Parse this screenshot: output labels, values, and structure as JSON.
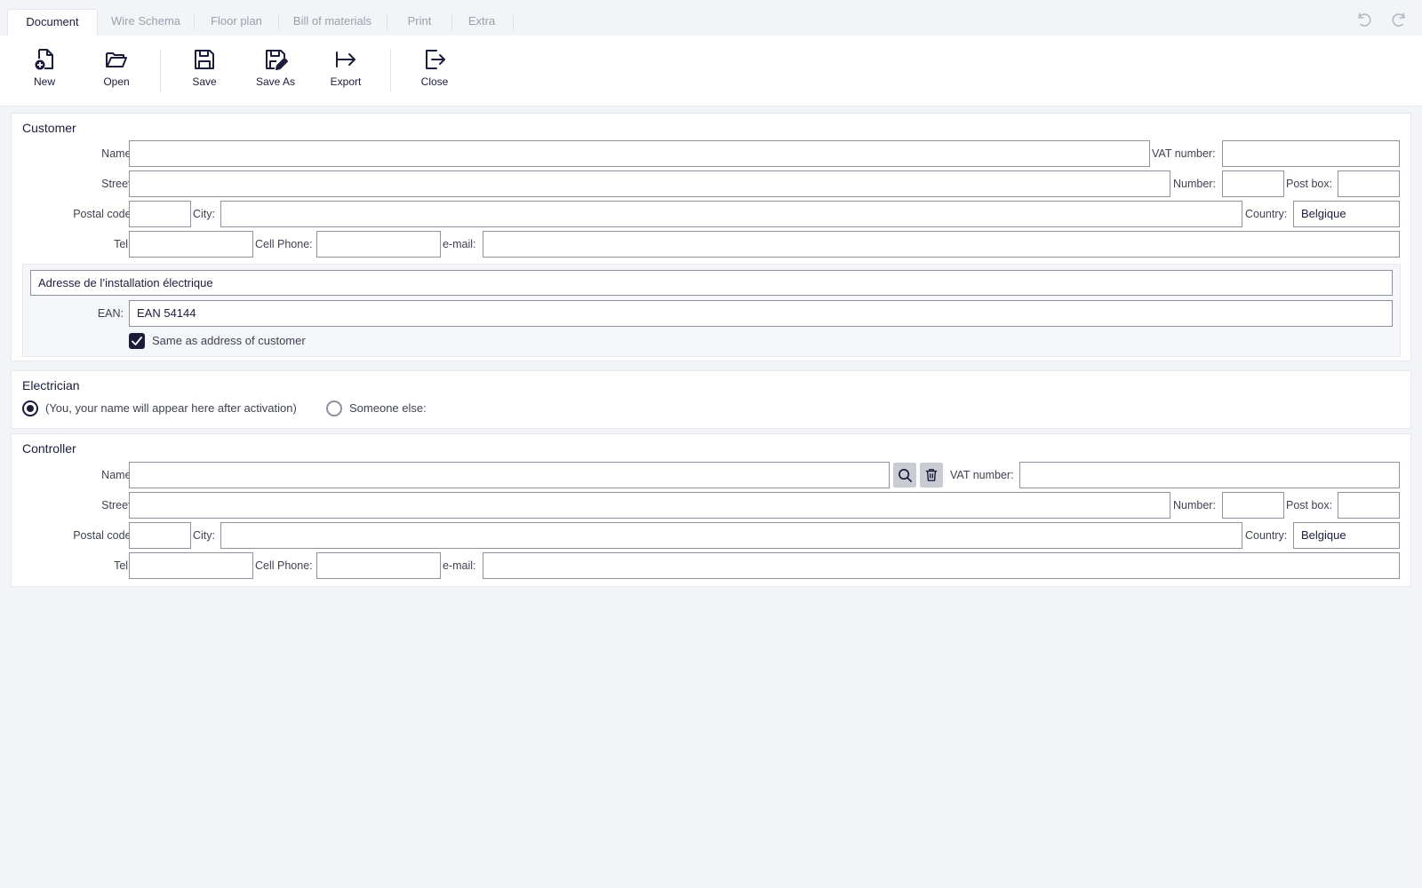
{
  "tabs": [
    "Document",
    "Wire Schema",
    "Floor plan",
    "Bill of materials",
    "Print",
    "Extra"
  ],
  "active_tab": "Document",
  "toolbar": {
    "new": "New",
    "open": "Open",
    "save": "Save",
    "save_as": "Save As",
    "export": "Export",
    "close": "Close"
  },
  "customer": {
    "title": "Customer",
    "labels": {
      "name": "Name:",
      "vat": "VAT number:",
      "street": "Street:",
      "number": "Number:",
      "postbox": "Post box:",
      "postal": "Postal code:",
      "city": "City:",
      "country": "Country:",
      "tel": "Tel.:",
      "cell": "Cell Phone:",
      "email": "e-mail:"
    },
    "values": {
      "name": "",
      "vat": "",
      "street": "",
      "number": "",
      "postbox": "",
      "postal": "",
      "city": "",
      "country": "Belgique",
      "tel": "",
      "cell": "",
      "email": ""
    },
    "installation": {
      "title": "Adresse de l’installation électrique",
      "ean_label": "EAN:",
      "ean_value": "EAN 54144",
      "same_address_label": "Same as address of customer",
      "same_address_checked": true
    }
  },
  "electrician": {
    "title": "Electrician",
    "option_you": "(You, your name will appear here after activation)",
    "option_else": "Someone else:",
    "selected": "you"
  },
  "controller": {
    "title": "Controller",
    "labels": {
      "name": "Name:",
      "vat": "VAT number:",
      "street": "Street:",
      "number": "Number:",
      "postbox": "Post box:",
      "postal": "Postal code:",
      "city": "City:",
      "country": "Country:",
      "tel": "Tel.:",
      "cell": "Cell Phone:",
      "email": "e-mail:"
    },
    "values": {
      "name": "",
      "vat": "",
      "street": "",
      "number": "",
      "postbox": "",
      "postal": "",
      "city": "",
      "country": "Belgique",
      "tel": "",
      "cell": "",
      "email": ""
    }
  },
  "colors": {
    "primary": "#1b1d3b",
    "background": "#f2f4f7",
    "panel": "#ffffff",
    "inactive_tab_text": "#9aa0ab"
  },
  "icons": {
    "new": "file-plus-icon",
    "open": "folder-open-icon",
    "save": "floppy-disk-icon",
    "save_as": "floppy-disk-pencil-icon",
    "export": "arrow-right-to-line-icon",
    "close": "exit-icon",
    "undo": "undo-icon",
    "redo": "redo-icon",
    "search": "search-icon",
    "delete": "trash-icon"
  }
}
